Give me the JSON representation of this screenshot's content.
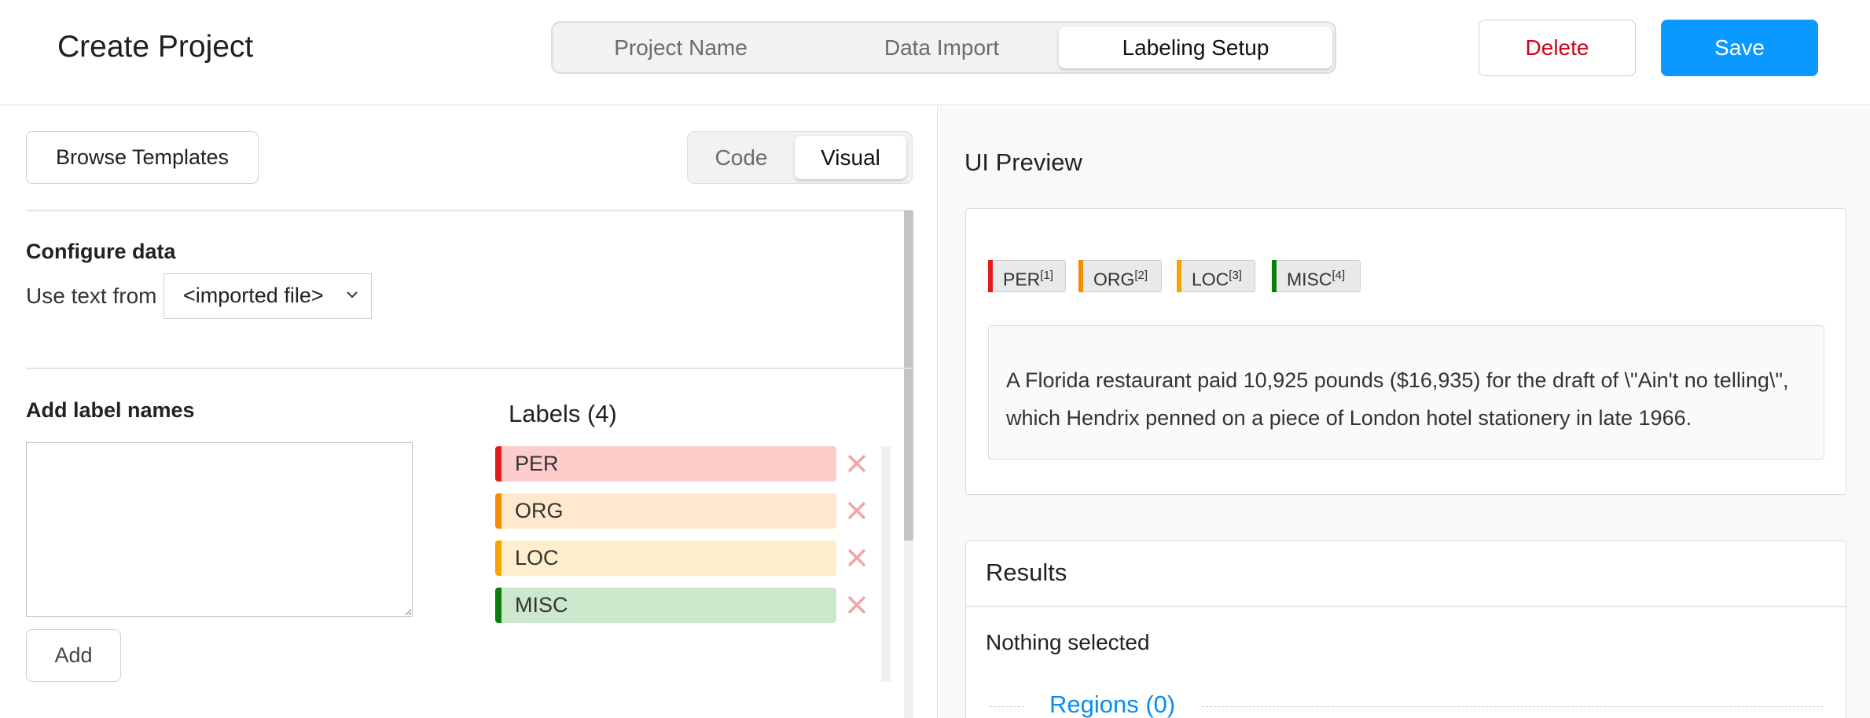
{
  "header": {
    "title": "Create Project",
    "steps": [
      "Project Name",
      "Data Import",
      "Labeling Setup"
    ],
    "active_step": "Labeling Setup",
    "delete_label": "Delete",
    "save_label": "Save"
  },
  "left": {
    "browse_label": "Browse Templates",
    "modes": [
      "Code",
      "Visual"
    ],
    "active_mode": "Visual",
    "configure_title": "Configure data",
    "use_text_label": "Use text from",
    "use_text_value": "<imported file>",
    "add_label_title": "Add label names",
    "add_button": "Add",
    "labels_title": "Labels (4)",
    "labels": [
      {
        "name": "PER",
        "color": "#e31b1b",
        "bg": "#ffcccc"
      },
      {
        "name": "ORG",
        "color": "#f28c00",
        "bg": "#ffe8cc"
      },
      {
        "name": "LOC",
        "color": "#f5a400",
        "bg": "#ffedcc"
      },
      {
        "name": "MISC",
        "color": "#0a7e0a",
        "bg": "#cce8cc"
      }
    ]
  },
  "right": {
    "preview_title": "UI Preview",
    "tags": [
      {
        "name": "PER",
        "sup": "[1]",
        "color": "#e31b1b"
      },
      {
        "name": "ORG",
        "sup": "[2]",
        "color": "#f28c00"
      },
      {
        "name": "LOC",
        "sup": "[3]",
        "color": "#f5a400"
      },
      {
        "name": "MISC",
        "sup": "[4]",
        "color": "#0a7e0a"
      }
    ],
    "text": "A Florida restaurant paid 10,925 pounds ($16,935) for the draft of \\\"Ain't no telling\\\", which Hendrix penned on a piece of London hotel stationery in late 1966.",
    "results_title": "Results",
    "nothing_selected": "Nothing selected",
    "regions": "Regions (0)"
  }
}
